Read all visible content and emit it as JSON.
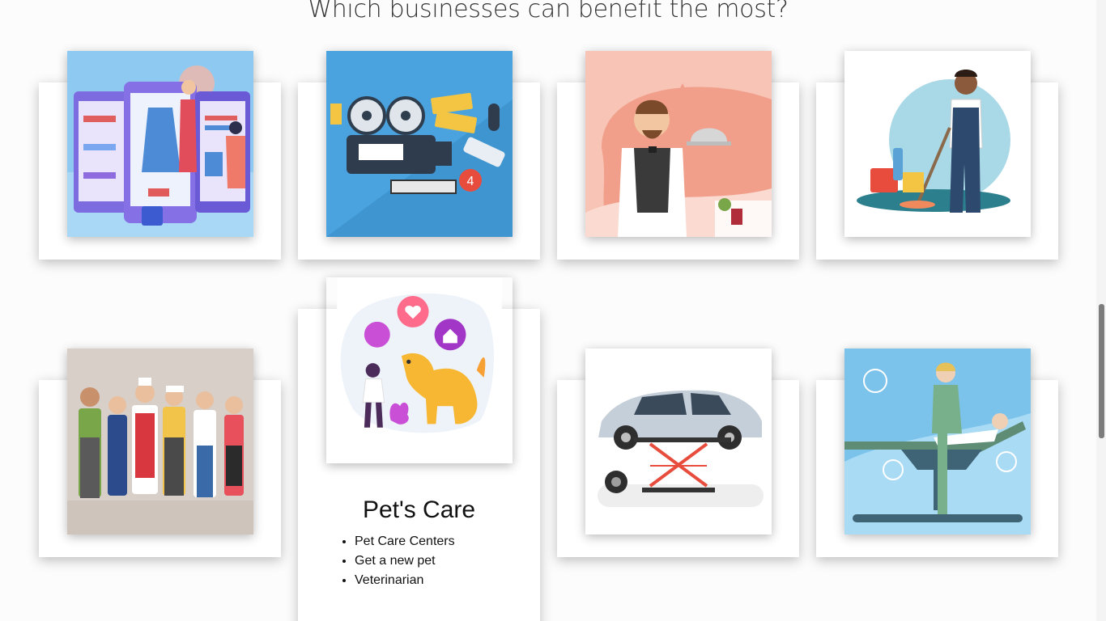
{
  "section": {
    "heading": "Which businesses can benefit the most?"
  },
  "cards": [
    {
      "name": "retail-shopping",
      "icon": "online-shopping-illustration"
    },
    {
      "name": "cinema-media",
      "icon": "cinema-illustration"
    },
    {
      "name": "restaurant",
      "icon": "waiter-illustration"
    },
    {
      "name": "cleaning",
      "icon": "cleaner-illustration"
    },
    {
      "name": "services-workers",
      "icon": "workers-group-illustration"
    },
    {
      "name": "pets-care",
      "icon": "pet-care-illustration",
      "title": "Pet's Care",
      "items": [
        "Pet Care Centers",
        "Get a new pet",
        "Veterinarian"
      ]
    },
    {
      "name": "auto-repair",
      "icon": "car-lift-illustration"
    },
    {
      "name": "spa-beauty",
      "icon": "spa-treatment-illustration"
    }
  ],
  "colors": {
    "background": "#fcfcfc",
    "card": "#ffffff",
    "heading": "#333333"
  }
}
